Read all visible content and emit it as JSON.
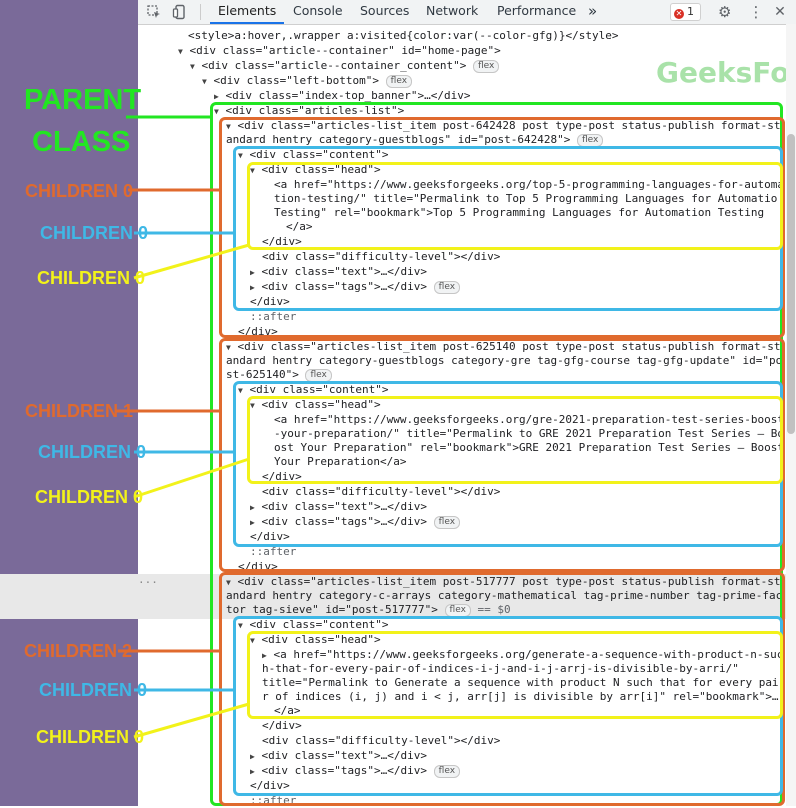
{
  "devtools": {
    "tabs": [
      "Elements",
      "Console",
      "Sources",
      "Network",
      "Performance"
    ],
    "more_tabs": "»",
    "error_count": "1",
    "watermark": "GeeksForGeeks"
  },
  "dom": {
    "style_line": "<style>a:hover,.wrapper a:visited{color:var(--color-gfg)}</style>",
    "container": {
      "open": "<div class=\"article--container\" id=\"home-page\">"
    },
    "container_content": {
      "open": "<div class=\"article--container_content\">",
      "badge": "flex"
    },
    "left_bottom": {
      "open": "<div class=\"left-bottom\">",
      "badge": "flex"
    },
    "index_banner": "<div class=\"index-top_banner\">…</div>",
    "articles_list": "<div class=\"articles-list\">",
    "items": [
      {
        "open1": "<div class=\"articles-list_item post-642428 post type-post status-publish format-st",
        "open2": "andard hentry category-guestblogs\" id=\"post-642428\">",
        "badge": "flex",
        "content": "<div class=\"content\">",
        "head": "<div class=\"head\">",
        "a1": "<a href=\"https://www.geeksforgeeks.org/top-5-programming-languages-for-automa",
        "a2": "tion-testing/\" title=\"Permalink to Top 5 Programming Languages for Automatio",
        "a3": "Testing\" rel=\"bookmark\">Top 5 Programming Languages for Automation Testing",
        "a_close": "</a>",
        "head_close": "</div>",
        "difficulty": "<div class=\"difficulty-level\"></div>",
        "text": "<div class=\"text\">…</div>",
        "tags": "<div class=\"tags\">…</div>",
        "tags_badge": "flex",
        "content_close": "</div>",
        "after": "::after",
        "item_close": "</div>"
      },
      {
        "open1": "<div class=\"articles-list_item post-625140 post type-post status-publish format-st",
        "open2": "andard hentry category-guestblogs category-gre tag-gfg-course tag-gfg-update\" id=\"po",
        "open3": "st-625140\">",
        "badge": "flex",
        "content": "<div class=\"content\">",
        "head": "<div class=\"head\">",
        "a1": "<a href=\"https://www.geeksforgeeks.org/gre-2021-preparation-test-series-boost",
        "a2": "-your-preparation/\" title=\"Permalink to GRE 2021 Preparation Test Series – Bo",
        "a3": "ost Your Preparation\" rel=\"bookmark\">GRE 2021 Preparation Test Series – Boost",
        "a4": "Your Preparation</a>",
        "head_close": "</div>",
        "difficulty": "<div class=\"difficulty-level\"></div>",
        "text": "<div class=\"text\">…</div>",
        "tags": "<div class=\"tags\">…</div>",
        "tags_badge": "flex",
        "content_close": "</div>",
        "after": "::after",
        "item_close": "</div>"
      },
      {
        "open1": "<div class=\"articles-list_item post-517777 post type-post status-publish format-st",
        "open2": "andard hentry category-c-arrays category-mathematical tag-prime-number tag-prime-fac",
        "open3": "tor tag-sieve\" id=\"post-517777\">",
        "badge": "flex",
        "selected_marker": "== $0",
        "dots": "···",
        "content": "<div class=\"content\">",
        "head": "<div class=\"head\">",
        "a1": "<a href=\"https://www.geeksforgeeks.org/generate-a-sequence-with-product-n-suc",
        "a2": "h-that-for-every-pair-of-indices-i-j-and-i-j-arrj-is-divisible-by-arri/\"",
        "a3": "title=\"Permalink to Generate a sequence with product N such that for every pai",
        "a4": "r of indices (i, j) and i < j, arr[j] is divisible by arr[i]\" rel=\"bookmark\">…",
        "a_close": "</a>",
        "head_close": "</div>",
        "difficulty": "<div class=\"difficulty-level\"></div>",
        "text": "<div class=\"text\">…</div>",
        "tags": "<div class=\"tags\">…</div>",
        "tags_badge": "flex",
        "content_close": "</div>",
        "after": "::after"
      }
    ]
  },
  "annotations": {
    "parent_line1": "PARENT",
    "parent_line2": "CLASS",
    "child0_orange": "CHILDREN 0",
    "child1_orange": "CHILDREN 1",
    "child2_orange": "CHILDREN 2",
    "child0_blue": "CHILDREN 0",
    "child0_yellow": "CHILDREN 0"
  },
  "colors": {
    "sidebar": "#7a6a99",
    "green": "#22e622",
    "orange": "#e06a2e",
    "blue": "#3fb8e6",
    "yellow": "#f2f21a"
  }
}
